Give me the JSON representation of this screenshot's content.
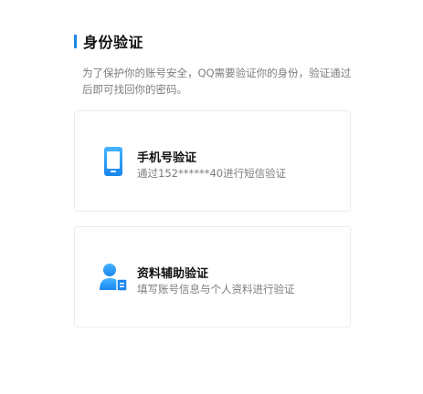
{
  "header": {
    "title": "身份验证",
    "accent_color": "#1e88e5"
  },
  "description": "为了保护你的账号安全，QQ需要验证你的身份，验证通过后即可找回你的密码。",
  "options": [
    {
      "title": "手机号验证",
      "subtitle": "通过152******40进行短信验证",
      "icon": "phone-icon"
    },
    {
      "title": "资料辅助验证",
      "subtitle": "填写账号信息与个人资料进行验证",
      "icon": "user-profile-icon"
    }
  ]
}
